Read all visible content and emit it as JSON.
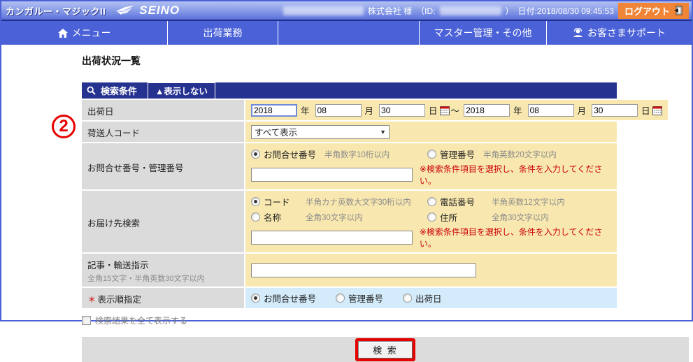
{
  "header": {
    "app_title": "カンガルー・マジックII",
    "brand": "SEINO",
    "company_suffix": "株式会社 様",
    "id_open": "（ID:",
    "id_close": "）",
    "datetime": "日付:2018/08/30 09:45:53",
    "logout_label": "ログアウト"
  },
  "nav": {
    "menu": "メニュー",
    "shipping": "出荷業務",
    "master": "マスター管理・その他",
    "support": "お客さまサポート"
  },
  "page": {
    "annotation_number": "2",
    "title": "出荷状況一覧"
  },
  "search_panel": {
    "header_label": "検索条件",
    "toggle_label": "▲表示しない",
    "ship_date": {
      "label": "出荷日",
      "from": {
        "year": "2018",
        "month": "08",
        "day": "30"
      },
      "to": {
        "year": "2018",
        "month": "08",
        "day": "30"
      },
      "unit_year": "年",
      "unit_month": "月",
      "unit_day": "日",
      "tilde": "～"
    },
    "shipper_code": {
      "label": "荷送人コード",
      "selected_value": "すべて表示"
    },
    "inquiry": {
      "label": "お問合せ番号・管理番号",
      "options": [
        {
          "label": "お問合せ番号",
          "hint": "半角数字10桁以内",
          "selected": true
        },
        {
          "label": "管理番号",
          "hint": "半角英数20文字以内",
          "selected": false
        }
      ],
      "input_value": "",
      "note": "※検索条件項目を選択し、条件を入力してください。"
    },
    "destination": {
      "label": "お届け先検索",
      "options": [
        {
          "label": "コード",
          "hint": "半角カナ英数大文字30桁以内",
          "selected": true
        },
        {
          "label": "電話番号",
          "hint": "半角英数12文字以内",
          "selected": false
        },
        {
          "label": "名称",
          "hint": "全角30文字以内",
          "selected": false
        },
        {
          "label": "住所",
          "hint": "全角30文字以内",
          "selected": false
        }
      ],
      "input_value": "",
      "note": "※検索条件項目を選択し、条件を入力してください。"
    },
    "article": {
      "label": "記事・輸送指示",
      "sublabel": "全角15文字・半角英数30文字以内",
      "input_value": ""
    },
    "order": {
      "required_mark": "＊",
      "label": "表示順指定",
      "options": [
        {
          "label": "お問合せ番号",
          "selected": true
        },
        {
          "label": "管理番号",
          "selected": false
        },
        {
          "label": "出荷日",
          "selected": false
        }
      ]
    }
  },
  "below_panel": {
    "show_all_checkbox_label": "検索結果を全て表示する",
    "search_button_label": "検 索"
  },
  "colors": {
    "nav_blue": "#4a61d8",
    "panel_navy": "#26328f",
    "label_gray": "#dbdbdb",
    "value_yellow": "#f8e8b0",
    "order_light_blue": "#d3ebfa",
    "logout_orange": "#f08437",
    "annotation_red": "#e60000",
    "note_red": "#cc0000"
  }
}
